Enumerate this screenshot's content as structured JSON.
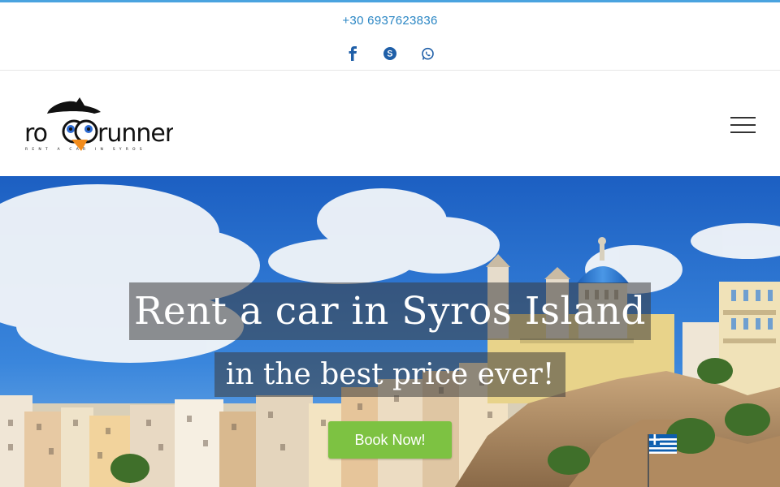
{
  "topbar": {
    "phone": "+30 6937623836",
    "socials": [
      {
        "name": "facebook-icon"
      },
      {
        "name": "skype-icon"
      },
      {
        "name": "whatsapp-icon"
      }
    ]
  },
  "header": {
    "logo": {
      "wordmark": "roadrunner",
      "tagline": "RENT A CAR IN SYROS"
    },
    "menu_icon": "hamburger-icon"
  },
  "hero": {
    "headline": "Rent a car in Syros Island",
    "subheadline": "in the best price ever!",
    "cta_label": "Book Now!"
  },
  "colors": {
    "accent": "#4aa3df",
    "link": "#2a86c4",
    "cta": "#7dc242"
  }
}
